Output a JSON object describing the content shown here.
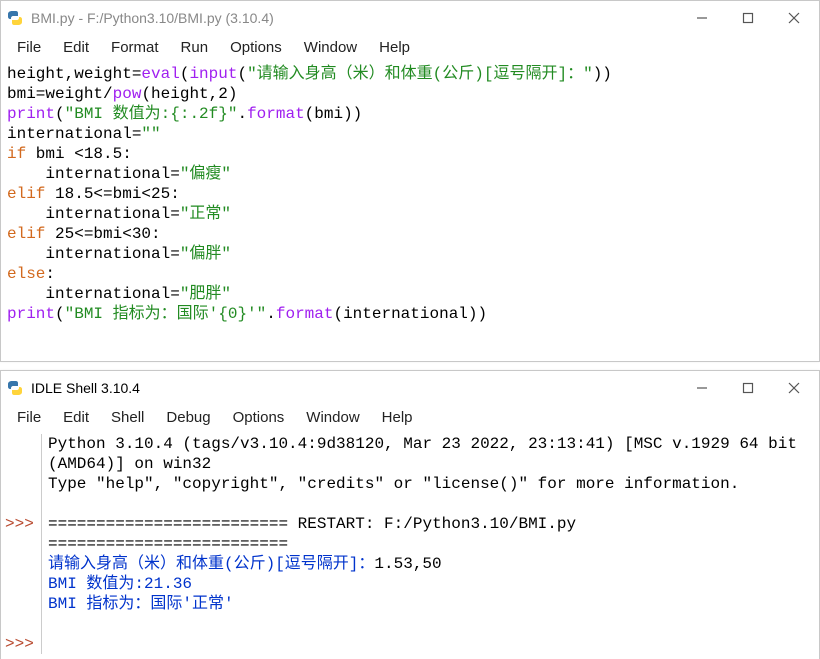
{
  "editor": {
    "title": "BMI.py - F:/Python3.10/BMI.py (3.10.4)",
    "menus": [
      "File",
      "Edit",
      "Format",
      "Run",
      "Options",
      "Window",
      "Help"
    ],
    "code": {
      "l1a": "height,weight=",
      "l1b": "eval",
      "l1c": "(",
      "l1d": "input",
      "l1e": "(",
      "l1f": "\"请输入身高（米）和体重(公斤)[逗号隔开]：\"",
      "l1g": "))",
      "l2a": "bmi=weight/",
      "l2b": "pow",
      "l2c": "(height,2)",
      "l3a": "print",
      "l3b": "(",
      "l3c": "\"BMI 数值为:{:.2f}\"",
      "l3d": ".",
      "l3e": "format",
      "l3f": "(bmi))",
      "l4": "international=",
      "l4s": "\"\"",
      "l5a": "if",
      "l5b": " bmi <18.5:",
      "l6": "    international=",
      "l6s": "\"偏瘦\"",
      "l7a": "elif",
      "l7b": " 18.5<=bmi<25:",
      "l8": "    international=",
      "l8s": "\"正常\"",
      "l9a": "elif",
      "l9b": " 25<=bmi<30:",
      "l10": "    international=",
      "l10s": "\"偏胖\"",
      "l11a": "else",
      "l11b": ":",
      "l12": "    international=",
      "l12s": "\"肥胖\"",
      "l13a": "print",
      "l13b": "(",
      "l13c": "\"BMI 指标为：国际'{0}'\"",
      "l13d": ".",
      "l13e": "format",
      "l13f": "(international))"
    }
  },
  "shell": {
    "title": "IDLE Shell 3.10.4",
    "menus": [
      "File",
      "Edit",
      "Shell",
      "Debug",
      "Options",
      "Window",
      "Help"
    ],
    "prompt": ">>>",
    "banner1": "Python 3.10.4 (tags/v3.10.4:9d38120, Mar 23 2022, 23:13:41) [MSC v.1929 64 bit (AMD64)] on win32",
    "banner2": "Type \"help\", \"copyright\", \"credits\" or \"license()\" for more information.",
    "restart": "========================= RESTART: F:/Python3.10/BMI.py =========================",
    "in_prompt": "请输入身高（米）和体重(公斤)[逗号隔开]：",
    "in_value": "1.53,50",
    "out1": "BMI 数值为:21.36",
    "out2": "BMI 指标为：国际'正常'"
  }
}
